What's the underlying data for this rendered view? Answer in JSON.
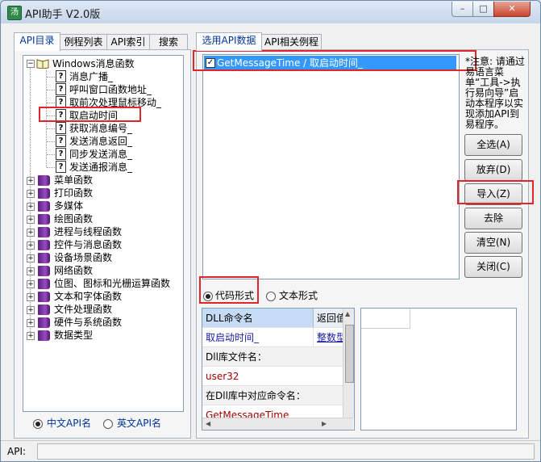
{
  "window": {
    "title": "API助手 V2.0版",
    "minimize": "–",
    "maximize": "□",
    "close": "✕"
  },
  "left_tabs": [
    "API目录",
    "例程列表",
    "API索引",
    "搜索"
  ],
  "tree": {
    "root_label": "Windows消息函数",
    "children": [
      "消息广播_",
      "呼叫窗口函数地址_",
      "取前次处理鼠标移动_",
      "取启动时间_",
      "获取消息编号_",
      "发送消息返回_",
      "同步发送消息_",
      "发送通报消息_"
    ],
    "categories": [
      "菜单函数",
      "打印函数",
      "多媒体",
      "绘图函数",
      "进程与线程函数",
      "控件与消息函数",
      "设备场景函数",
      "网络函数",
      "位图、图标和光栅运算函数",
      "文本和字体函数",
      "文件处理函数",
      "硬件与系统函数",
      "数据类型"
    ]
  },
  "name_mode": {
    "cn": "中文API名",
    "en": "英文API名",
    "selected": "cn"
  },
  "right_tabs": [
    "选用API数据",
    "API相关例程"
  ],
  "selected_list": [
    "GetMessageTime / 取启动时间_"
  ],
  "notice": "*注意: 请通过易语言菜单“工具->执行易向导”启动本程序以实现添加API到易程序。",
  "buttons": {
    "select_all": "全选(A)",
    "discard": "放弃(D)",
    "import": "导入(Z)",
    "remove": "去除",
    "clear": "清空(N)",
    "close": "关闭(C)"
  },
  "format": {
    "code": "代码形式",
    "text": "文本形式",
    "selected": "code"
  },
  "grid": {
    "col1_header": "DLL命令名",
    "col2_header": "返回值",
    "name_value": "取启动时间_",
    "return_value": "整数型",
    "lib_label": "Dll库文件名：",
    "lib_value": "user32",
    "cmd_label": "在Dll库中对应命令名：",
    "cmd_value": "GetMessageTime"
  },
  "status": {
    "label": "API:"
  },
  "colors": {
    "accent": "#3399ff",
    "highlight": "#e0262a",
    "book": "#7a2f9f"
  }
}
